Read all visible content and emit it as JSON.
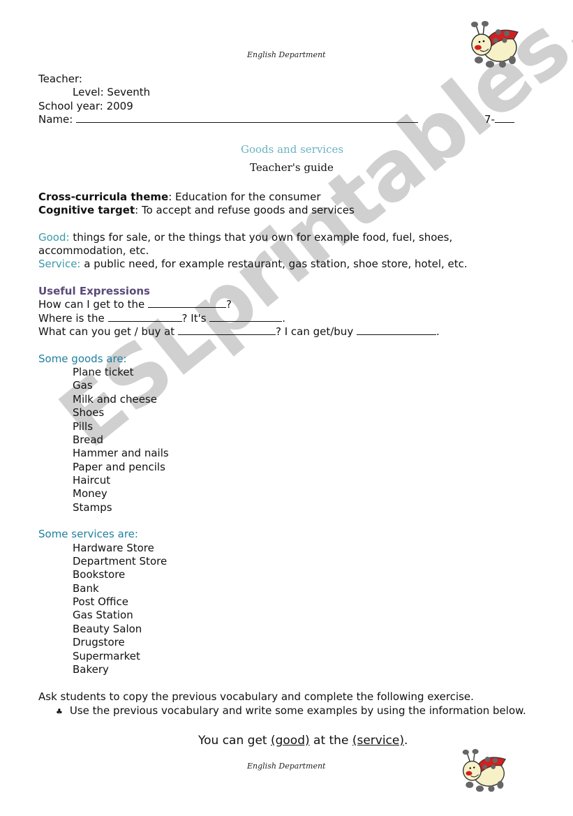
{
  "header": {
    "department": "English Department",
    "teacher_label": "Teacher:",
    "level": "Level: Seventh",
    "school_year": "School year: 2009",
    "name_label": "Name:",
    "group_label": "7-"
  },
  "title": {
    "main": "Goods and services",
    "sub": "Teacher's guide"
  },
  "meta": {
    "theme_label": "Cross-curricula theme",
    "theme_value": ": Education for the consumer",
    "target_label": "Cognitive target",
    "target_value": ": To accept and refuse goods and services"
  },
  "definitions": {
    "good_label": "Good:",
    "good_text_1": " things for sale, or the things that you own for example food, fuel, shoes,",
    "good_text_2": "accommodation, etc.",
    "service_label": "Service:",
    "service_text": " a public need, for example restaurant, gas station, shoe store, hotel, etc."
  },
  "expressions": {
    "heading": "Useful Expressions",
    "line1_a": "How can I get to the ",
    "line1_b": "?",
    "line2_a": "Where is the ",
    "line2_b": "? It's ",
    "line2_c": ".",
    "line3_a": "What can you get / buy at ",
    "line3_b": "? I can get/buy ",
    "line3_c": "."
  },
  "goods": {
    "heading": "Some goods are:",
    "items": [
      "Plane ticket",
      "Gas",
      "Milk and cheese",
      "Shoes",
      "Pills",
      "Bread",
      "Hammer and nails",
      "Paper and pencils",
      "Haircut",
      "Money",
      "Stamps"
    ]
  },
  "services": {
    "heading": "Some services are:",
    "items": [
      "Hardware Store",
      "Department Store",
      "Bookstore",
      "Bank",
      "Post Office",
      "Gas Station",
      "Beauty Salon",
      "Drugstore",
      "Supermarket",
      "Bakery"
    ]
  },
  "instructions": {
    "intro": "Ask students to copy the previous vocabulary and complete the following exercise.",
    "bullet_icon": "club-bullet-icon",
    "bullet_glyph": "♣",
    "bullet_text": "Use the previous vocabulary and write some examples by using the information below."
  },
  "model_sentence": {
    "part1": "You can get ",
    "good": "(good)",
    "part2": " at the ",
    "service": "(service)",
    "part3": "."
  },
  "footer": {
    "department": "English Department"
  },
  "watermark": "ESLprintables.com"
}
